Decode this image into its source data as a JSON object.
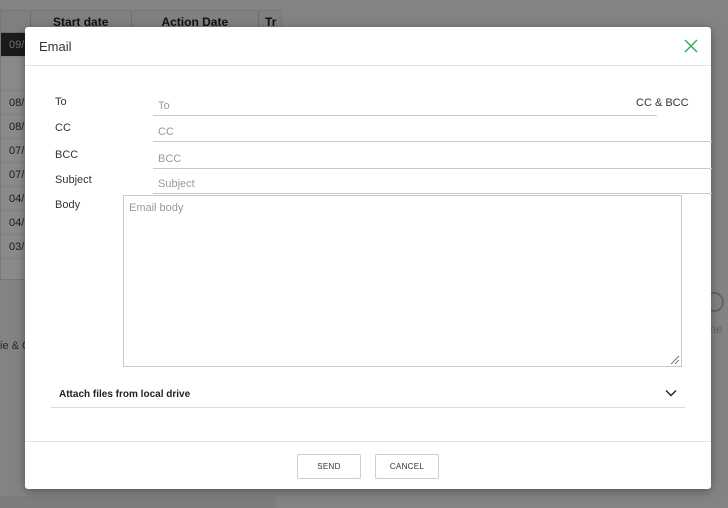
{
  "background": {
    "table_headers": [
      "",
      "Start date",
      "Action Date",
      "Tr"
    ],
    "rows": [
      "09/",
      "08/",
      "08/",
      "07/",
      "07/",
      "04/",
      "04/",
      "03/"
    ],
    "side_text": "ie & C",
    "right_text": "me"
  },
  "dialog": {
    "title": "Email",
    "close_icon": "close-icon",
    "accent_color": "#2eae5a",
    "to": {
      "label": "To",
      "placeholder": "To",
      "value": ""
    },
    "cc_bcc_toggle": "CC & BCC",
    "cc": {
      "label": "CC",
      "placeholder": "CC",
      "value": ""
    },
    "bcc": {
      "label": "BCC",
      "placeholder": "BCC",
      "value": ""
    },
    "subject": {
      "label": "Subject",
      "placeholder": "Subject",
      "value": ""
    },
    "body": {
      "label": "Body",
      "placeholder": "Email body",
      "value": ""
    },
    "attach": {
      "label": "Attach files from local drive",
      "icon": "chevron-down-icon"
    },
    "buttons": {
      "send": "SEND",
      "cancel": "CANCEL"
    }
  }
}
